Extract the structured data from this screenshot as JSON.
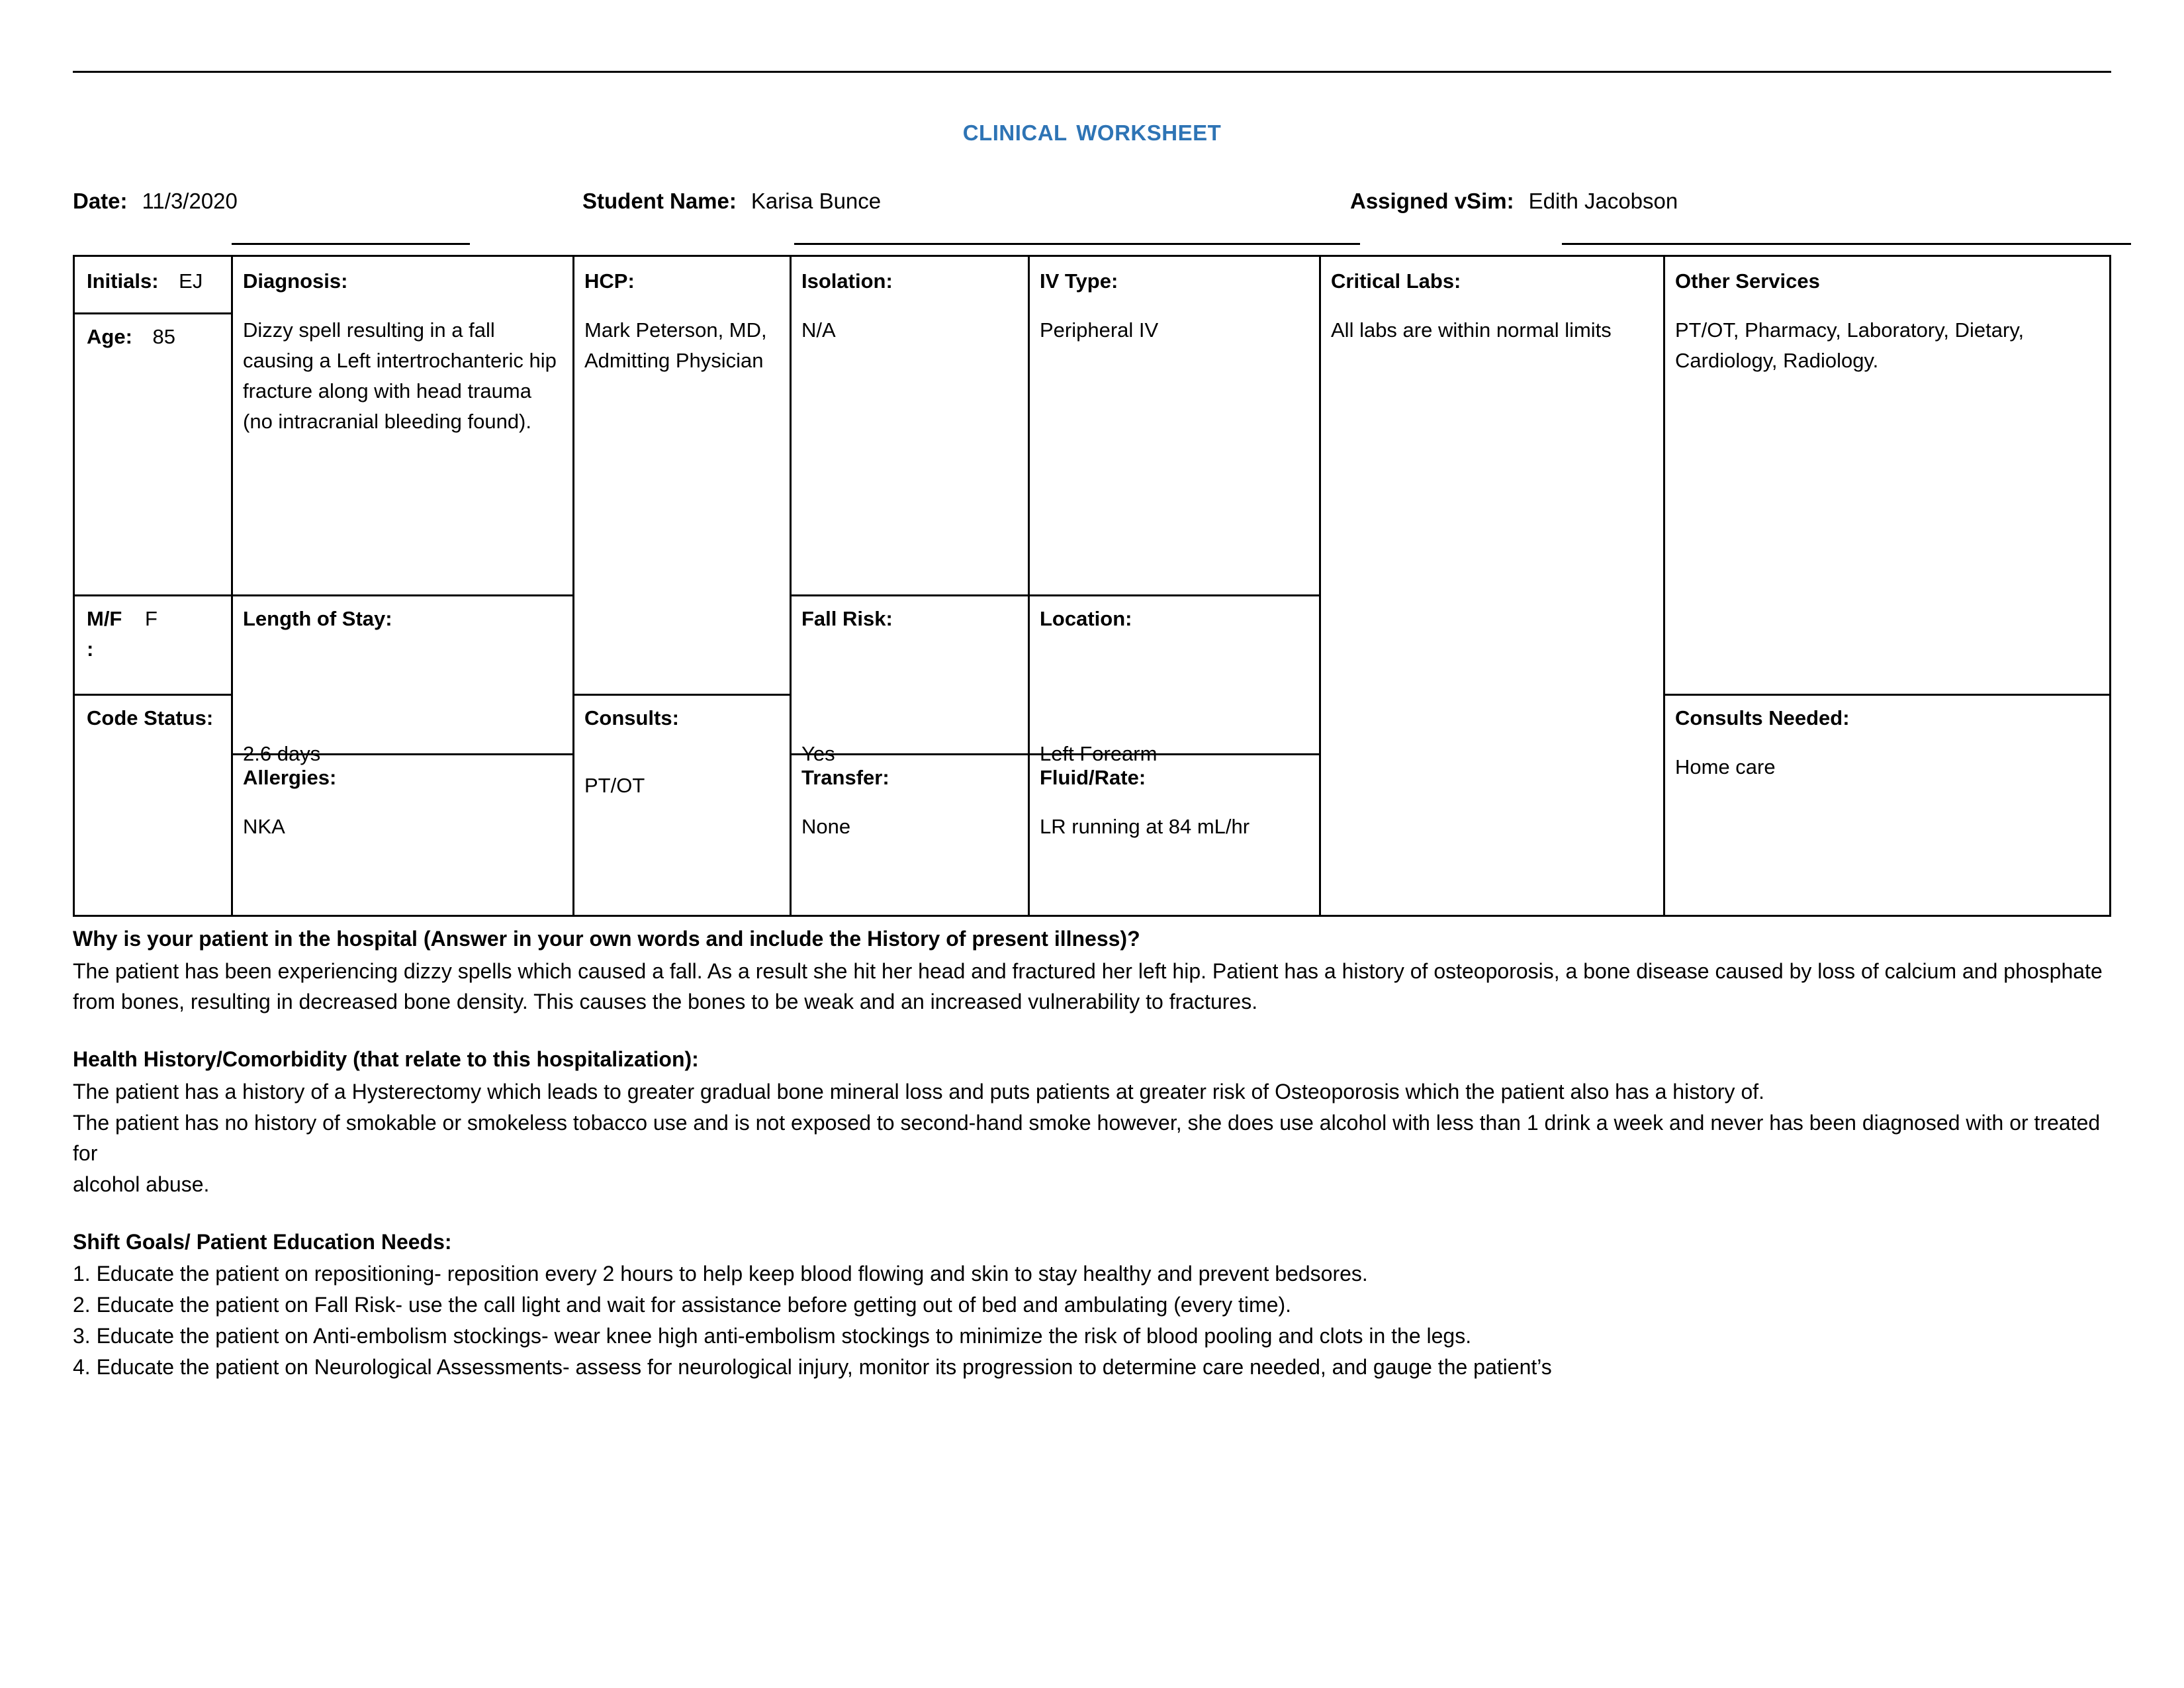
{
  "document": {
    "title": "Clinical Worksheet"
  },
  "header": {
    "date_label": "Date:",
    "date_value": "11/3/2020",
    "student_label": "Student Name:",
    "student_value": "Karisa Bunce",
    "vsim_label": "Assigned vSim:",
    "vsim_value": "Edith Jacobson"
  },
  "table": {
    "initials_label": "Initials:",
    "initials_value": "EJ",
    "age_label": "Age:",
    "age_value": "85",
    "mf_label": "M/F",
    "mf_value": "F",
    "mf_colon": ":",
    "code_status_label": "Code Status:",
    "code_status_value": "",
    "diagnosis_label": "Diagnosis:",
    "diagnosis_value": "Dizzy spell resulting in a fall causing a Left intertrochanteric hip fracture along with head trauma (no intracranial bleeding found).",
    "length_of_stay_label": "Length of Stay:",
    "length_of_stay_value": "2.6 days",
    "allergies_label": "Allergies:",
    "allergies_value": "NKA",
    "hcp_label": "HCP:",
    "hcp_value": "Mark Peterson, MD, Admitting Physician",
    "consults_label": "Consults:",
    "consults_value": "PT/OT",
    "isolation_label": "Isolation:",
    "isolation_value": "N/A",
    "fall_risk_label": "Fall Risk:",
    "fall_risk_value": "Yes",
    "transfer_label": "Transfer:",
    "transfer_value": "None",
    "iv_type_label": "IV Type:",
    "iv_type_value": "Peripheral IV",
    "location_label": "Location:",
    "location_value": "Left Forearm",
    "fluid_rate_label": "Fluid/Rate:",
    "fluid_rate_value": "LR running at 84 mL/hr",
    "critical_labs_label": "Critical Labs:",
    "critical_labs_value": "All labs are within normal limits",
    "other_services_label": "Other Services",
    "other_services_value": "PT/OT, Pharmacy, Laboratory, Dietary, Cardiology, Radiology.",
    "consults_needed_label": "Consults Needed:",
    "consults_needed_value": "Home care"
  },
  "sections": {
    "why_heading": "Why is your patient in the hospital (Answer in your own words and include the History of present illness)?",
    "why_body": "The patient has been experiencing dizzy spells which caused a fall. As a result she hit her head and fractured her left hip. Patient has a history of osteoporosis, a bone disease caused by loss of calcium and phosphate from bones, resulting in decreased bone density. This causes the bones to be weak and an increased vulnerability to fractures.",
    "history_heading": "Health History/Comorbidity (that relate to this hospitalization):",
    "history_body_1": "The patient has a history of a Hysterectomy which leads to greater gradual bone mineral loss and puts patients at greater risk of Osteoporosis which the patient also has a history of.",
    "history_body_2": "The patient has no history of smokable or smokeless tobacco use and is not exposed to second-hand smoke however, she does use alcohol with less than 1 drink a week and never has been diagnosed with or treated for",
    "history_body_3": "alcohol abuse.",
    "goals_heading": "Shift Goals/ Patient Education Needs:",
    "goals": [
      "1. Educate the patient on repositioning- reposition every 2 hours to help keep blood flowing and skin to stay healthy and prevent bedsores.",
      "2. Educate the patient on Fall Risk- use the call light and wait for assistance before getting out of bed and ambulating (every time).",
      "3. Educate the patient on Anti-embolism stockings- wear knee high anti-embolism stockings to minimize the risk of blood pooling and clots in the legs.",
      "4. Educate the patient on Neurological Assessments- assess for neurological injury, monitor its progression to determine care needed, and gauge the patient’s"
    ]
  },
  "colors": {
    "title_blue": "#2E74B5",
    "rule_black": "#000000"
  }
}
